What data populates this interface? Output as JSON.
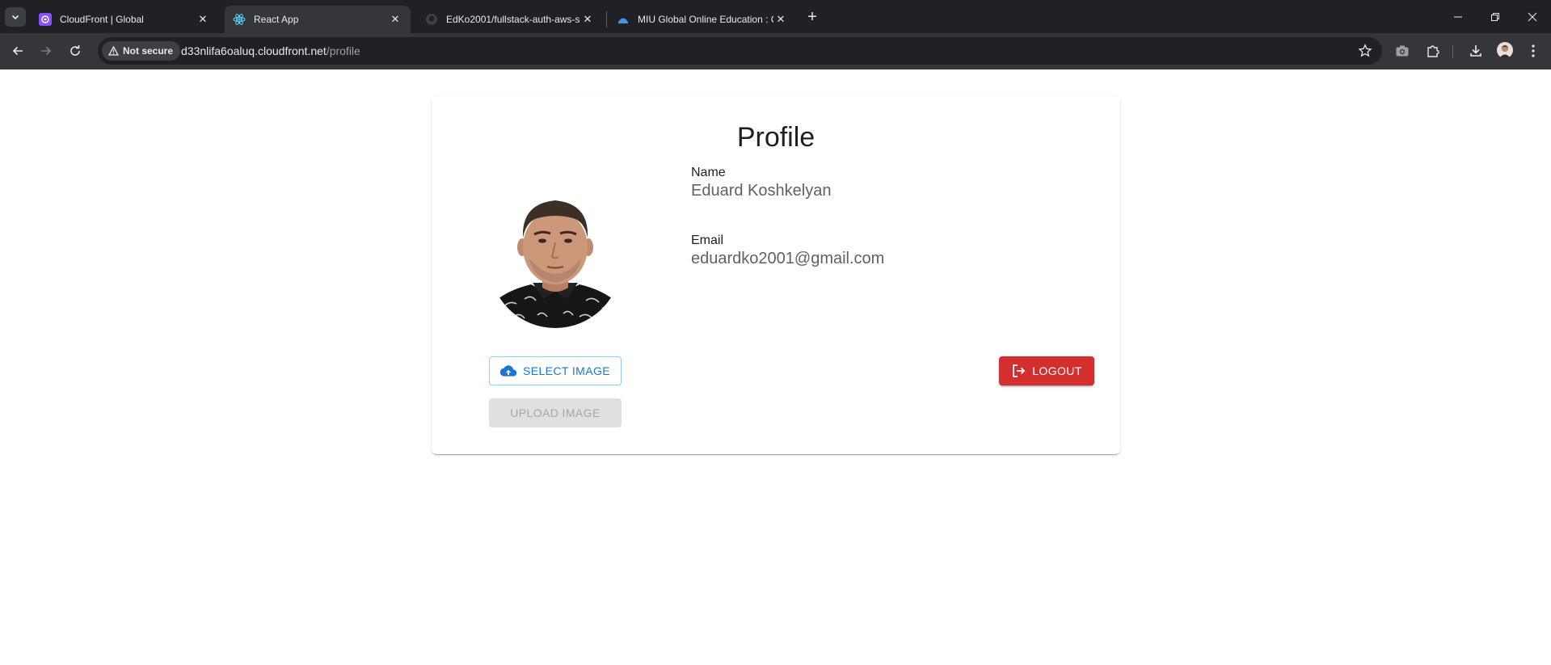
{
  "browser": {
    "tabs": [
      {
        "title": "CloudFront | Global",
        "active": false
      },
      {
        "title": "React App",
        "active": true
      },
      {
        "title": "EdKo2001/fullstack-auth-aws-se",
        "active": false
      },
      {
        "title": "MIU Global Online Education : C",
        "active": false
      }
    ],
    "security_label": "Not secure",
    "url_host": "d33nlifa6oaluq.cloudfront.net",
    "url_path": "/profile"
  },
  "page": {
    "title": "Profile",
    "name_label": "Name",
    "name_value": "Eduard Koshkelyan",
    "email_label": "Email",
    "email_value": "eduardko2001@gmail.com",
    "select_image_label": "SELECT IMAGE",
    "upload_image_label": "UPLOAD IMAGE",
    "logout_label": "LOGOUT"
  },
  "colors": {
    "primary": "#1976d2",
    "danger": "#d32f2f",
    "chrome_dark": "#202124",
    "chrome_toolbar": "#35363a"
  }
}
